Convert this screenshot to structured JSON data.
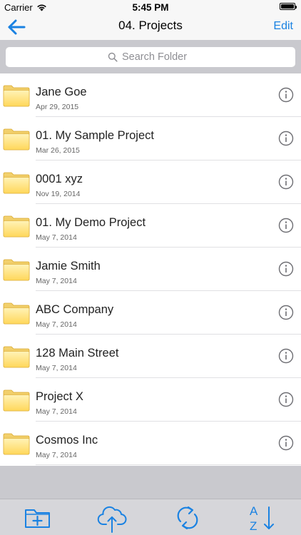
{
  "status_bar": {
    "carrier": "Carrier",
    "time": "5:45 PM"
  },
  "nav": {
    "title": "04. Projects",
    "edit_label": "Edit",
    "accent_color": "#1a82e2"
  },
  "search": {
    "placeholder": "Search Folder",
    "value": ""
  },
  "folders": [
    {
      "name": "Jane Goe",
      "date": "Apr 29, 2015"
    },
    {
      "name": "01. My Sample Project",
      "date": "Mar 26, 2015"
    },
    {
      "name": "0001 xyz",
      "date": "Nov 19, 2014"
    },
    {
      "name": "01. My Demo Project",
      "date": "May 7, 2014"
    },
    {
      "name": "Jamie Smith",
      "date": "May 7, 2014"
    },
    {
      "name": "ABC Company",
      "date": "May 7, 2014"
    },
    {
      "name": "128 Main Street",
      "date": "May 7, 2014"
    },
    {
      "name": "Project X",
      "date": "May 7, 2014"
    },
    {
      "name": "Cosmos Inc",
      "date": "May 7, 2014"
    }
  ],
  "toolbar": {
    "items": [
      "add-folder-icon",
      "cloud-upload-icon",
      "sync-icon",
      "sort-az-icon"
    ]
  }
}
